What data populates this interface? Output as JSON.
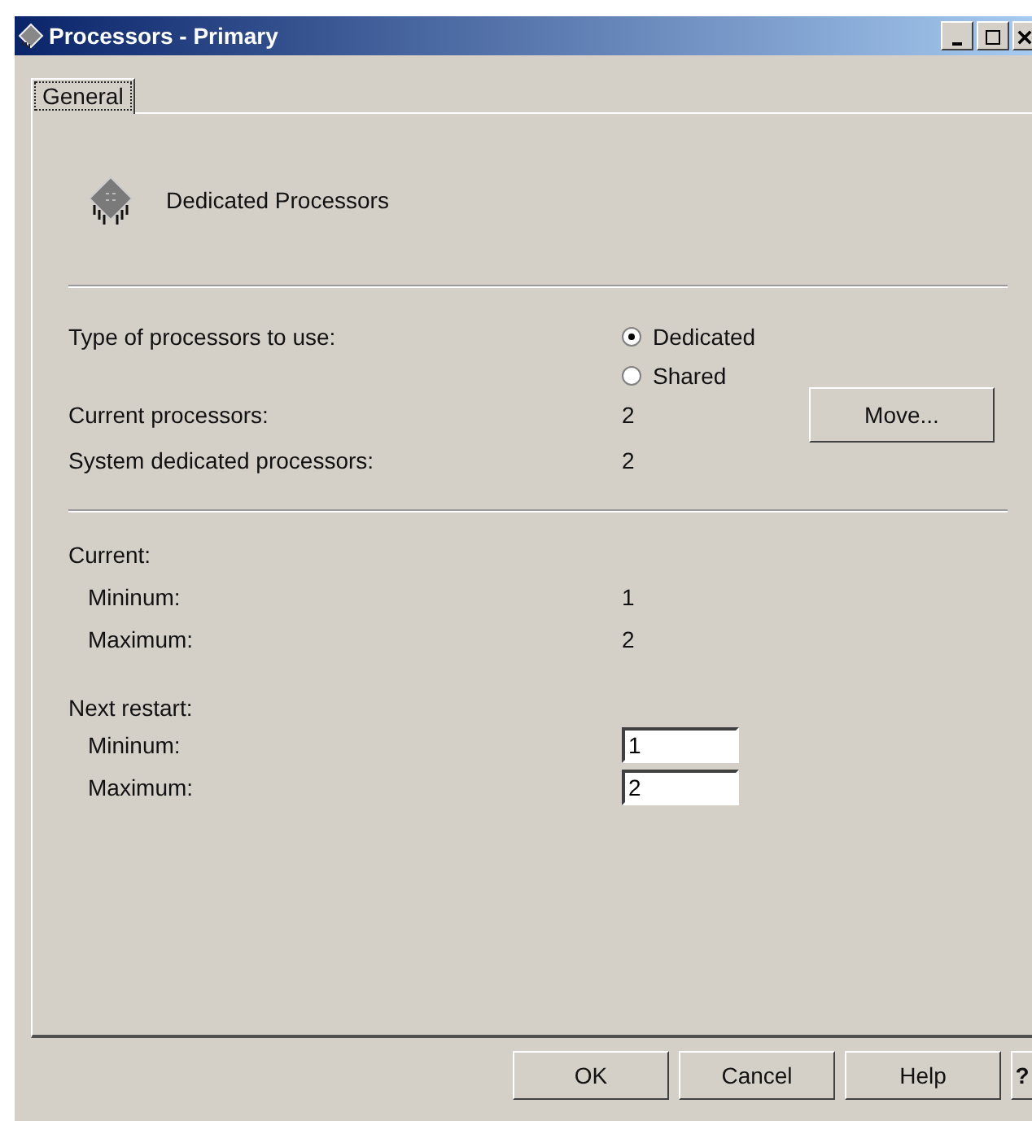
{
  "window": {
    "title": "Processors - Primary"
  },
  "tabs": [
    {
      "label": "General",
      "selected": true
    }
  ],
  "header": {
    "title": "Dedicated Processors"
  },
  "processor_type": {
    "label": "Type of processors to use:",
    "options": [
      {
        "label": "Dedicated",
        "selected": true
      },
      {
        "label": "Shared",
        "selected": false
      }
    ]
  },
  "info_rows": [
    {
      "label": "Current processors:",
      "value": "2"
    },
    {
      "label": "System dedicated processors:",
      "value": "2"
    }
  ],
  "move_button": "Move...",
  "current": {
    "heading": "Current:",
    "rows": [
      {
        "label": "Mininum:",
        "value": "1"
      },
      {
        "label": "Maximum:",
        "value": "2"
      }
    ]
  },
  "next_restart": {
    "heading": "Next restart:",
    "fields": [
      {
        "label": "Mininum:",
        "value": "1"
      },
      {
        "label": "Maximum:",
        "value": "2"
      }
    ]
  },
  "buttons": [
    "OK",
    "Cancel",
    "Help",
    "?"
  ]
}
